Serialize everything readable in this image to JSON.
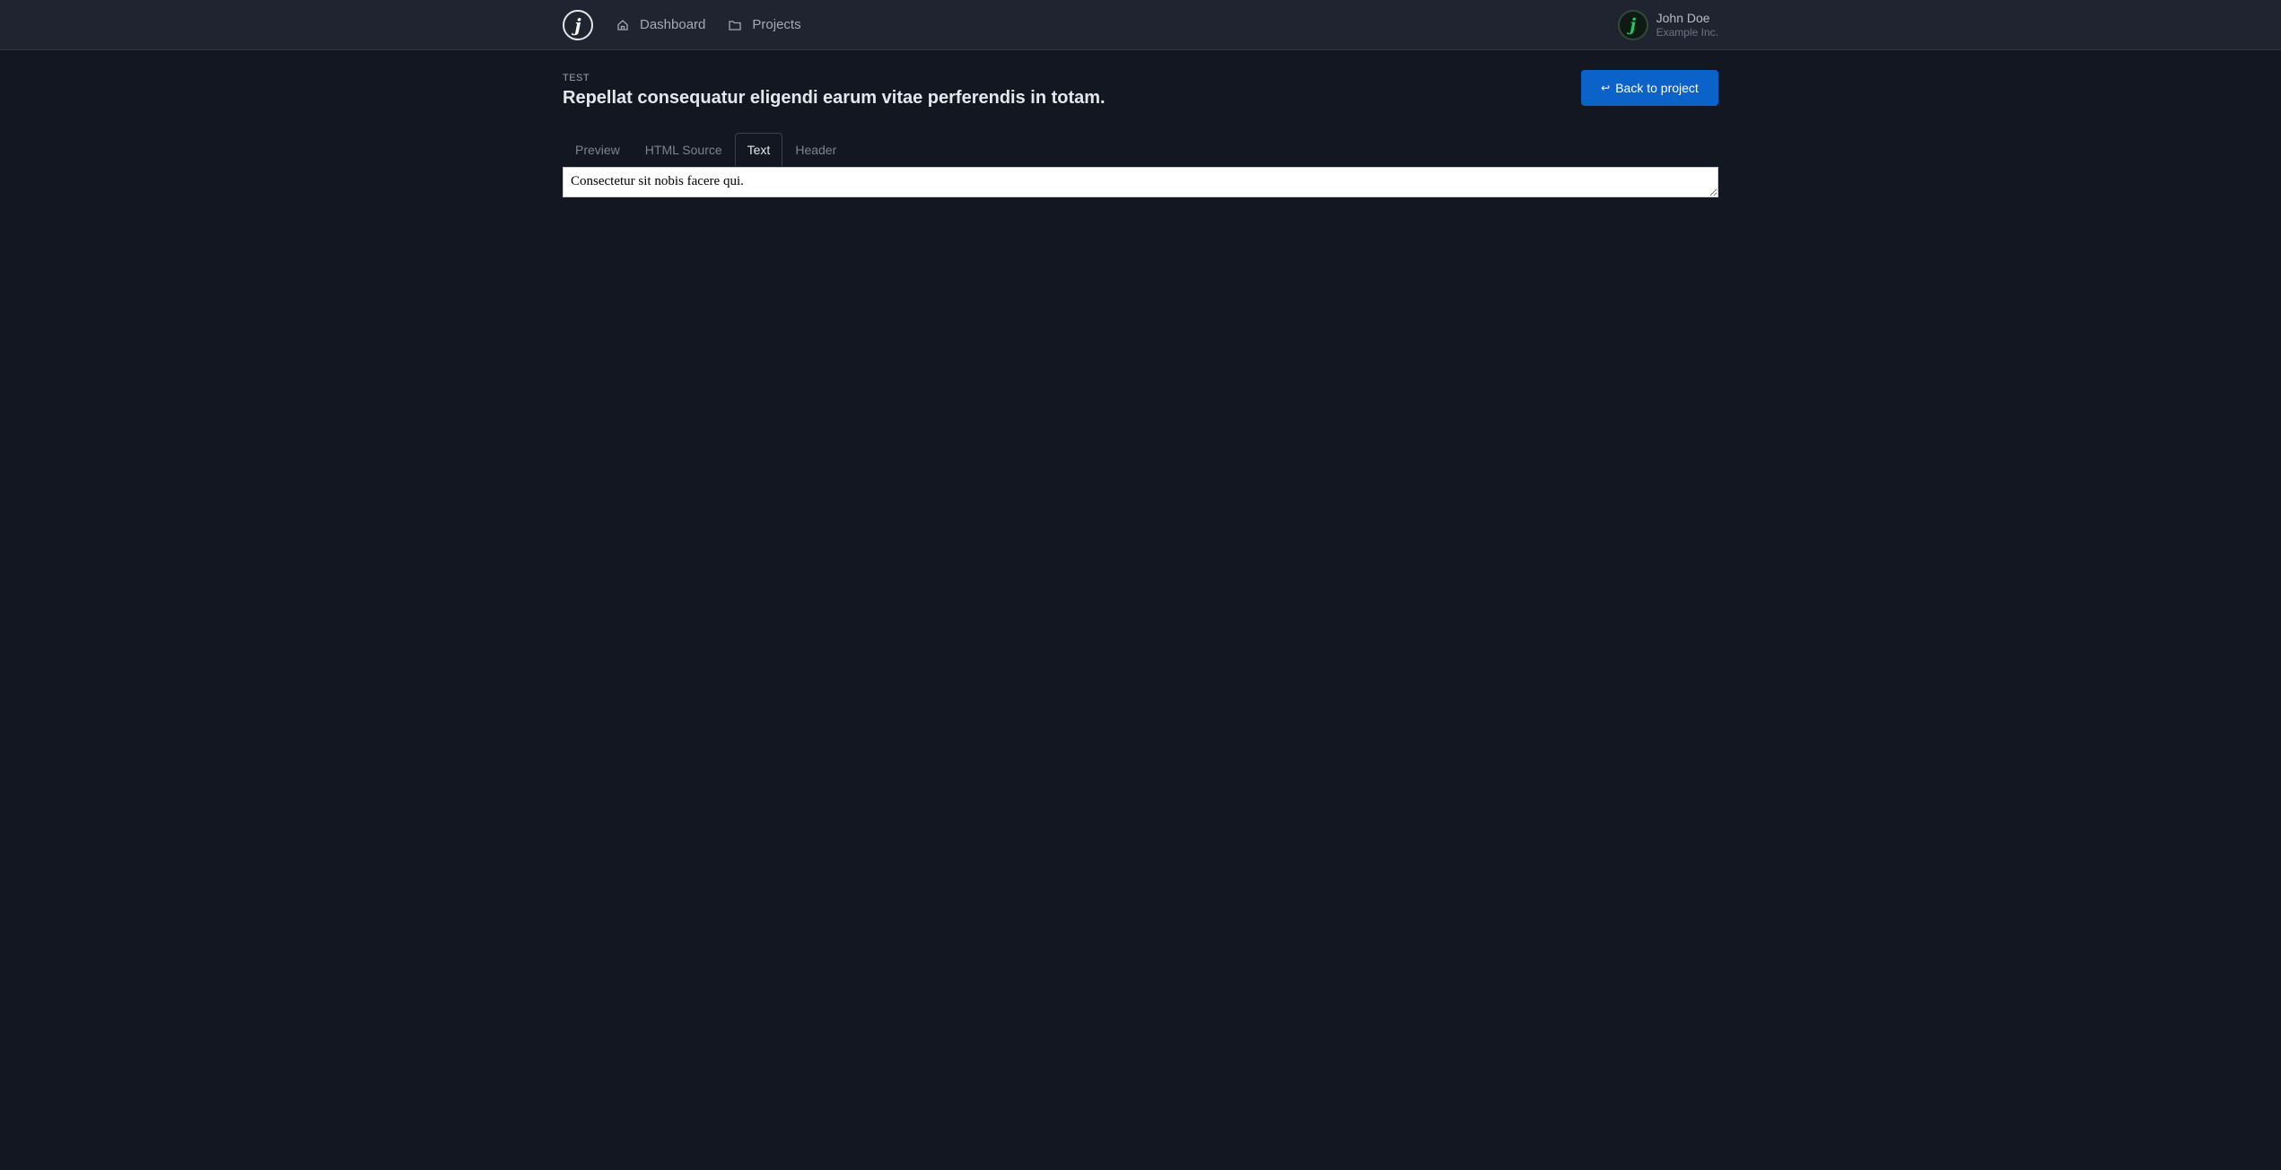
{
  "nav": {
    "logo_letter": "j",
    "items": [
      {
        "label": "Dashboard",
        "icon": "home-icon"
      },
      {
        "label": "Projects",
        "icon": "folder-icon"
      }
    ]
  },
  "user": {
    "avatar_letter": "j",
    "name": "John Doe",
    "org": "Example Inc."
  },
  "page": {
    "kicker": "TEST",
    "title": "Repellat consequatur eligendi earum vitae perferendis in totam.",
    "back_button": "Back to project"
  },
  "tabs": [
    "Preview",
    "HTML Source",
    "Text",
    "Header"
  ],
  "active_tab": "Text",
  "editor": {
    "value": "Consectetur sit nobis facere qui."
  },
  "colors": {
    "accent": "#0b63c9",
    "background": "#131722",
    "topbar": "#1f2430"
  }
}
